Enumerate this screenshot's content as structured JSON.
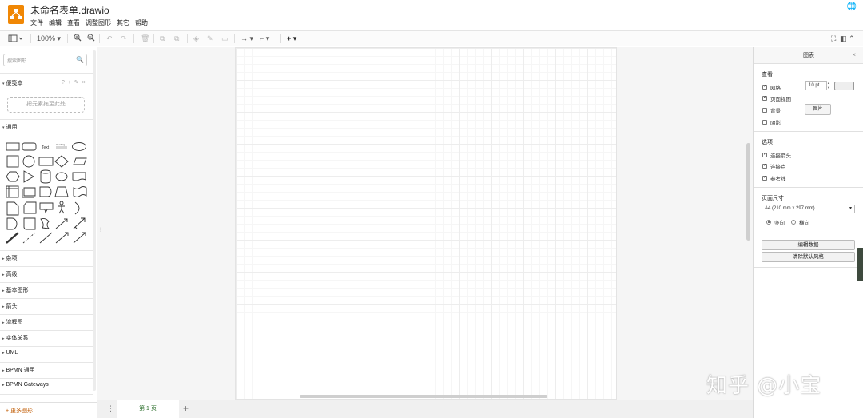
{
  "app": {
    "title": "未命名表单.drawio",
    "menu": [
      "文件",
      "编辑",
      "查看",
      "调整图形",
      "其它",
      "帮助"
    ],
    "brand_color": "#f08705"
  },
  "toolbar": {
    "zoom": "100%"
  },
  "sidebar": {
    "search_placeholder": "搜索图形",
    "scratchpad_title": "便笺本",
    "scratchpad_tools": "? + ✎ ×",
    "dropzone_text": "把元素拖至此处",
    "general_title": "通用",
    "shape_text_label": "Text",
    "shape_heading_label": "Heading",
    "categories": [
      "杂项",
      "高级",
      "基本图形",
      "箭头",
      "流程图",
      "实体关系",
      "UML",
      "BPMN 通用",
      "BPMN Gateways"
    ],
    "more_shapes": "+ 更多图形..."
  },
  "pages": {
    "tabs": [
      "第 1 页"
    ]
  },
  "format_panel": {
    "title": "图表",
    "view_section": "查看",
    "grid_label": "网格",
    "grid_checked": true,
    "grid_size": "10 pt",
    "page_view_label": "页面视图",
    "page_view_checked": true,
    "background_label": "背景",
    "background_checked": false,
    "image_button": "图片",
    "shadow_label": "阴影",
    "shadow_checked": false,
    "options_section": "选项",
    "connection_arrows_label": "连接箭头",
    "connection_arrows_checked": true,
    "connection_points_label": "连接点",
    "connection_points_checked": true,
    "guides_label": "参考线",
    "guides_checked": true,
    "paper_size_section": "页面尺寸",
    "paper_size_value": "A4 (210 mm x 297 mm)",
    "portrait_label": "竖向",
    "landscape_label": "横向",
    "orientation": "portrait",
    "edit_data_button": "编辑数据",
    "clear_style_button": "清除默认风格"
  },
  "watermark": "知乎 @小宝"
}
